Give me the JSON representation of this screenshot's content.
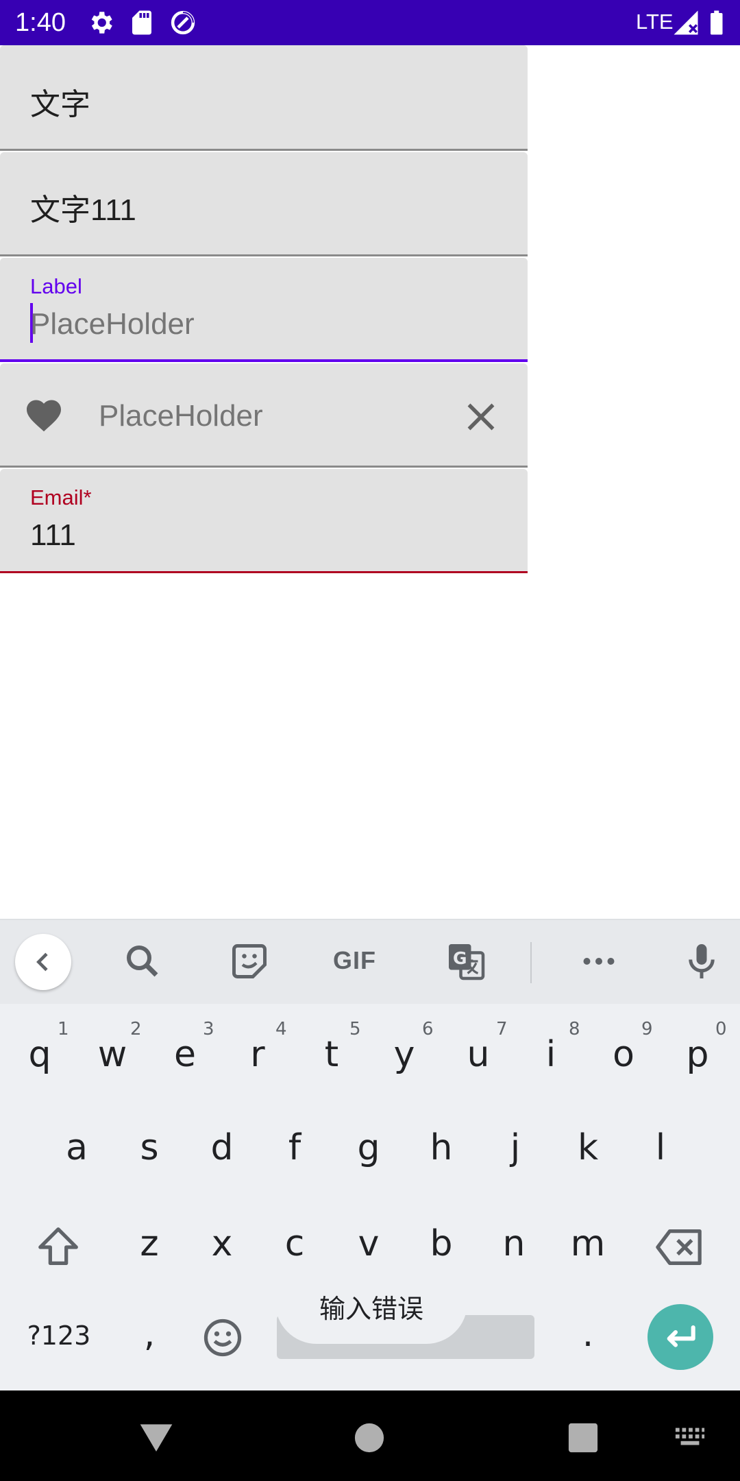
{
  "status_bar": {
    "time": "1:40",
    "network": "LTE",
    "icons": [
      "settings-icon",
      "sd-card-icon",
      "data-saver-icon",
      "signal-icon",
      "battery-icon"
    ]
  },
  "fields": {
    "field1": {
      "value": "文字"
    },
    "field2": {
      "value": "文字111"
    },
    "field3": {
      "label": "Label",
      "placeholder": "PlaceHolder"
    },
    "field4": {
      "placeholder": "PlaceHolder",
      "leading_icon": "heart-icon",
      "trailing_icon": "close-icon"
    },
    "field5": {
      "label": "Email*",
      "value": "111"
    }
  },
  "colors": {
    "status_bar": "#3700b3",
    "accent": "#6200ee",
    "error": "#b00020",
    "field_bg": "#e2e2e2",
    "enter_key": "#4db6ac"
  },
  "keyboard": {
    "toolbar": {
      "gif_label": "GIF",
      "icons": [
        "back-icon",
        "search-icon",
        "sticker-icon",
        "gif-icon",
        "translate-icon",
        "more-icon",
        "mic-icon"
      ]
    },
    "row1": [
      {
        "k": "q",
        "h": "1"
      },
      {
        "k": "w",
        "h": "2"
      },
      {
        "k": "e",
        "h": "3"
      },
      {
        "k": "r",
        "h": "4"
      },
      {
        "k": "t",
        "h": "5"
      },
      {
        "k": "y",
        "h": "6"
      },
      {
        "k": "u",
        "h": "7"
      },
      {
        "k": "i",
        "h": "8"
      },
      {
        "k": "o",
        "h": "9"
      },
      {
        "k": "p",
        "h": "0"
      }
    ],
    "row2": [
      "a",
      "s",
      "d",
      "f",
      "g",
      "h",
      "j",
      "k",
      "l"
    ],
    "row3": [
      "z",
      "x",
      "c",
      "v",
      "b",
      "n",
      "m"
    ],
    "row4": {
      "symbols": "?123",
      "comma": ",",
      "period": "."
    },
    "popup_text": "输入错误"
  }
}
